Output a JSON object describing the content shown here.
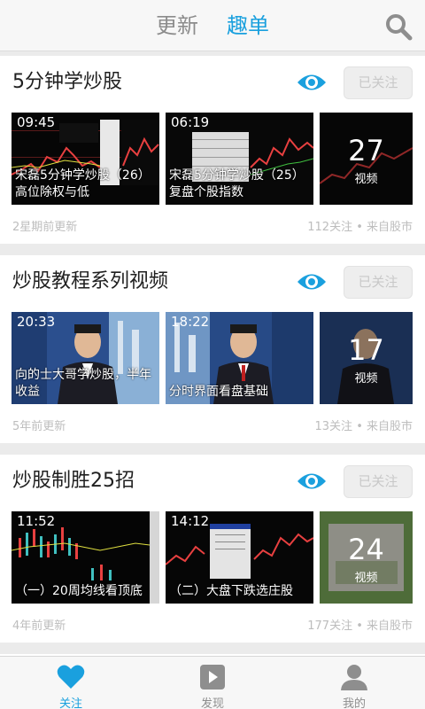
{
  "header": {
    "tabs": [
      {
        "label": "更新",
        "active": false
      },
      {
        "label": "趣单",
        "active": true
      }
    ],
    "search_icon": "search-icon"
  },
  "colors": {
    "accent": "#1aa0de",
    "inactive": "#8c8c8c"
  },
  "cards": [
    {
      "title": "5分钟学炒股",
      "follow_label": "已关注",
      "videos": [
        {
          "time": "09:45",
          "caption": "宋磊5分钟学炒股（26）高位除权与低"
        },
        {
          "time": "06:19",
          "caption": "宋磊5分钟学炒股（25）复盘个股指数"
        }
      ],
      "count": "27",
      "count_label": "视频",
      "updated": "2星期前更新",
      "stats": "112关注 • 来自股市"
    },
    {
      "title": "炒股教程系列视频",
      "follow_label": "已关注",
      "videos": [
        {
          "time": "20:33",
          "caption": "向的士大哥学炒股，半年收益"
        },
        {
          "time": "18:22",
          "caption": "分时界面看盘基础"
        }
      ],
      "count": "17",
      "count_label": "视频",
      "updated": "5年前更新",
      "stats": "13关注 • 来自股市"
    },
    {
      "title": "炒股制胜25招",
      "follow_label": "已关注",
      "videos": [
        {
          "time": "11:52",
          "caption": "（一）20周均线看顶底"
        },
        {
          "time": "14:12",
          "caption": "（二）大盘下跌选庄股"
        }
      ],
      "count": "24",
      "count_label": "视频",
      "updated": "4年前更新",
      "stats": "177关注 • 来自股市"
    }
  ],
  "bottom_nav": [
    {
      "label": "关注",
      "icon": "heart-icon",
      "active": true
    },
    {
      "label": "发现",
      "icon": "play-icon",
      "active": false
    },
    {
      "label": "我的",
      "icon": "person-icon",
      "active": false
    }
  ]
}
